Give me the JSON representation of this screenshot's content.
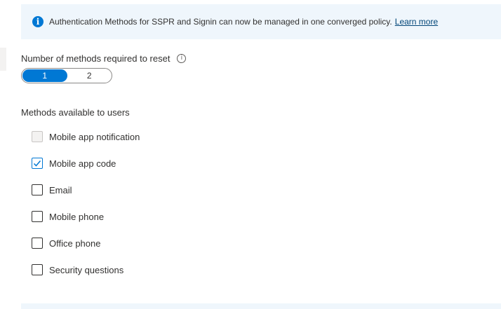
{
  "banner": {
    "icon": "info-icon",
    "text": "Authentication Methods for SSPR and Signin can now be managed in one converged policy.",
    "link": "Learn more"
  },
  "reset": {
    "label": "Number of methods required to reset",
    "tooltip_icon": "info-outline-icon",
    "options": [
      "1",
      "2"
    ],
    "selected": "1"
  },
  "methods": {
    "heading": "Methods available to users",
    "items": [
      {
        "label": "Mobile app notification",
        "checked": false,
        "disabled": true
      },
      {
        "label": "Mobile app code",
        "checked": true,
        "disabled": false
      },
      {
        "label": "Email",
        "checked": false,
        "disabled": false
      },
      {
        "label": "Mobile phone",
        "checked": false,
        "disabled": false
      },
      {
        "label": "Office phone",
        "checked": false,
        "disabled": false
      },
      {
        "label": "Security questions",
        "checked": false,
        "disabled": false
      }
    ]
  },
  "colors": {
    "accent": "#0078d4",
    "banner_bg": "#eff6fc",
    "link": "#004578"
  }
}
